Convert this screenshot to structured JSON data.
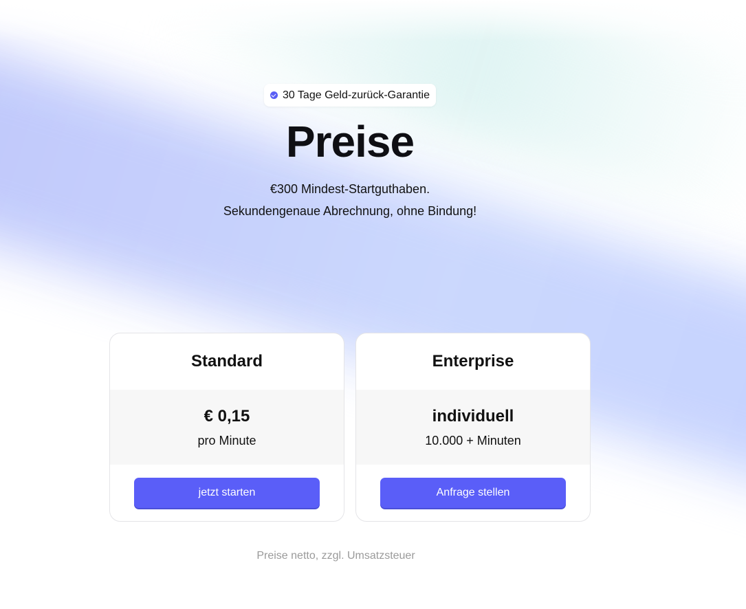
{
  "badge": {
    "icon": "check-badge-icon",
    "text": "30 Tage Geld-zurück-Garantie"
  },
  "hero": {
    "title": "Preise",
    "subtitle_line1": "€300 Mindest-Startguthaben.",
    "subtitle_line2": "Sekundengenaue Abrechnung, ohne Bindung!"
  },
  "plans": [
    {
      "name": "Standard",
      "price": "€ 0,15",
      "unit": "pro Minute",
      "button_label": "jetzt starten"
    },
    {
      "name": "Enterprise",
      "price": "individuell",
      "unit": "10.000 + Minuten",
      "button_label": "Anfrage stellen"
    }
  ],
  "footnote": "Preise netto, zzgl. Umsatzsteuer",
  "colors": {
    "accent": "#5a5ef8",
    "price_box_bg": "#f7f7f7",
    "footnote_text": "#9a9a9a"
  }
}
